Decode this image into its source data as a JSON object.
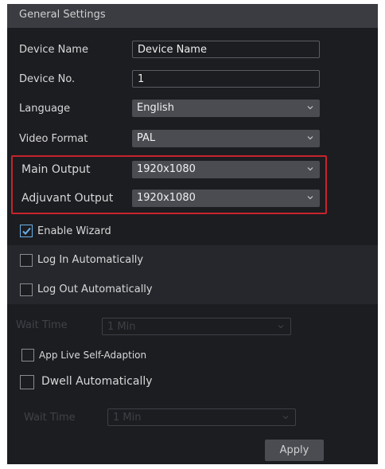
{
  "header": {
    "title": "General Settings"
  },
  "fields": {
    "device_name": {
      "label": "Device Name",
      "value": "Device Name"
    },
    "device_no": {
      "label": "Device No.",
      "value": "1"
    },
    "language": {
      "label": "Language",
      "value": "English"
    },
    "video_format": {
      "label": "Video Format",
      "value": "PAL"
    },
    "main_output": {
      "label": "Main Output",
      "value": "1920x1080"
    },
    "adjuvant_output": {
      "label": "Adjuvant Output",
      "value": "1920x1080"
    }
  },
  "checkboxes": {
    "enable_wizard": {
      "label": "Enable Wizard",
      "checked": true
    },
    "log_in_auto": {
      "label": "Log In Automatically",
      "checked": false
    },
    "log_out_auto": {
      "label": "Log Out Automatically",
      "checked": false
    },
    "app_live": {
      "label": "App Live Self-Adaption",
      "checked": false
    },
    "dwell_auto": {
      "label": "Dwell Automatically",
      "checked": false
    }
  },
  "wait_time_1": {
    "label": "Wait Time",
    "value": "1 Min"
  },
  "wait_time_2": {
    "label": "Wait Time",
    "value": "1 Min"
  },
  "apply_label": "Apply",
  "colors": {
    "highlight": "#c8232c",
    "check": "#6ab0e8",
    "panel": "#1c1d21"
  }
}
